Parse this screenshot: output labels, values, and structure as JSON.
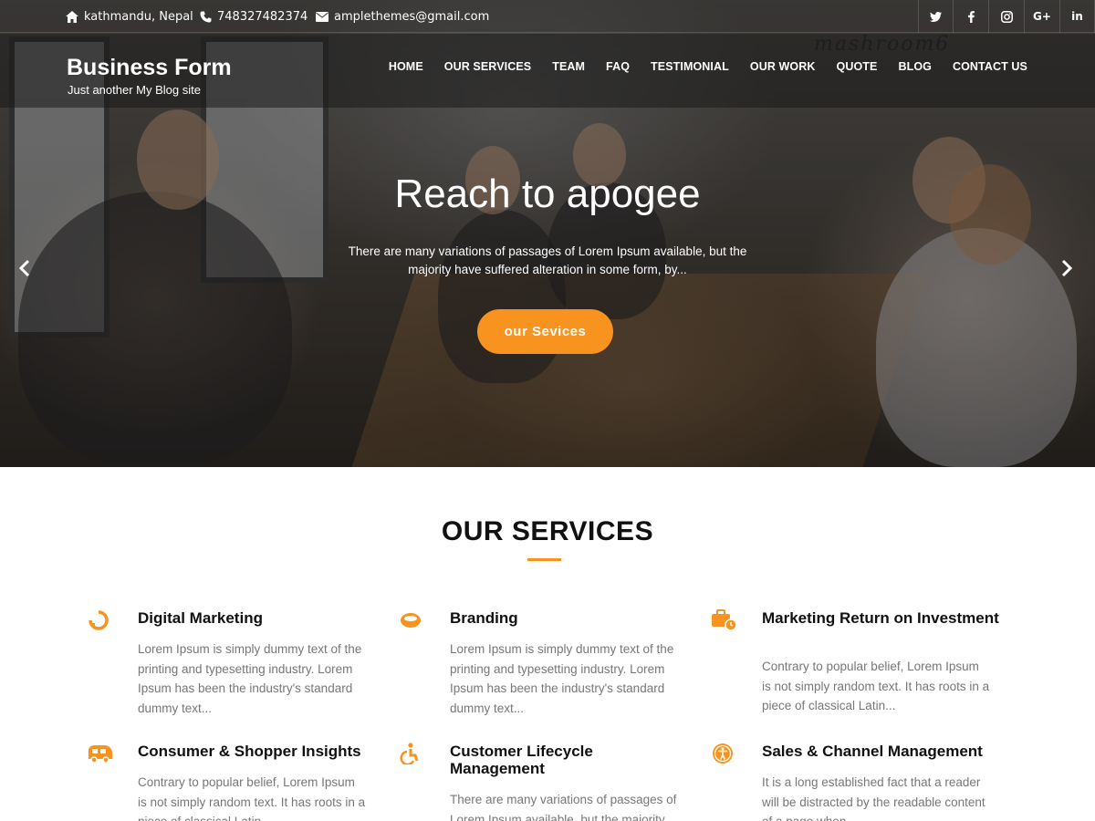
{
  "topbar": {
    "address": "kathmandu, Nepal",
    "phone": "748327482374",
    "email": "amplethemes@gmail.com",
    "socials": [
      "twitter-icon",
      "facebook-icon",
      "instagram-icon",
      "google-plus-icon",
      "linkedin-icon"
    ]
  },
  "header": {
    "site_title": "Business Form",
    "tagline": "Just another My Blog site",
    "watermark": "mashroom6",
    "nav": [
      "HOME",
      "OUR SERVICES",
      "TEAM",
      "FAQ",
      "TESTIMONIAL",
      "OUR WORK",
      "QUOTE",
      "BLOG",
      "CONTACT US"
    ]
  },
  "hero": {
    "title": "Reach to apogee",
    "text": "There are many variations of passages of Lorem Ipsum available, but the majority have suffered alteration in some form, by...",
    "button": "our Sevices"
  },
  "services": {
    "title": "OUR SERVICES",
    "accent_color": "#f7931e",
    "items": [
      {
        "title": "Digital Marketing",
        "desc": "Lorem Ipsum is simply dummy text of the printing and typesetting industry. Lorem Ipsum has been the industry's standard dummy text...",
        "icon": "digital-marketing-icon"
      },
      {
        "title": "Branding",
        "desc": "Lorem Ipsum is simply dummy text of the printing and typesetting industry. Lorem Ipsum has been the industry's standard dummy text...",
        "icon": "branding-icon"
      },
      {
        "title": "Marketing Return on Investment",
        "desc": "Contrary to popular belief, Lorem Ipsum is not simply random text. It has roots in a piece of classical Latin...",
        "icon": "briefcase-clock-icon"
      },
      {
        "title": "Consumer & Shopper Insights",
        "desc": "Contrary to popular belief, Lorem Ipsum is not simply random text. It has roots in a piece of classical Latin...",
        "icon": "shopper-insights-icon"
      },
      {
        "title": "Customer Lifecycle Management",
        "desc": "There are many variations of passages of Lorem Ipsum available, but the majority have...",
        "icon": "accessibility-icon"
      },
      {
        "title": "Sales & Channel Management",
        "desc": "It is a long established fact that a reader will be distracted by the readable content of a page when...",
        "icon": "universal-access-icon"
      }
    ]
  }
}
